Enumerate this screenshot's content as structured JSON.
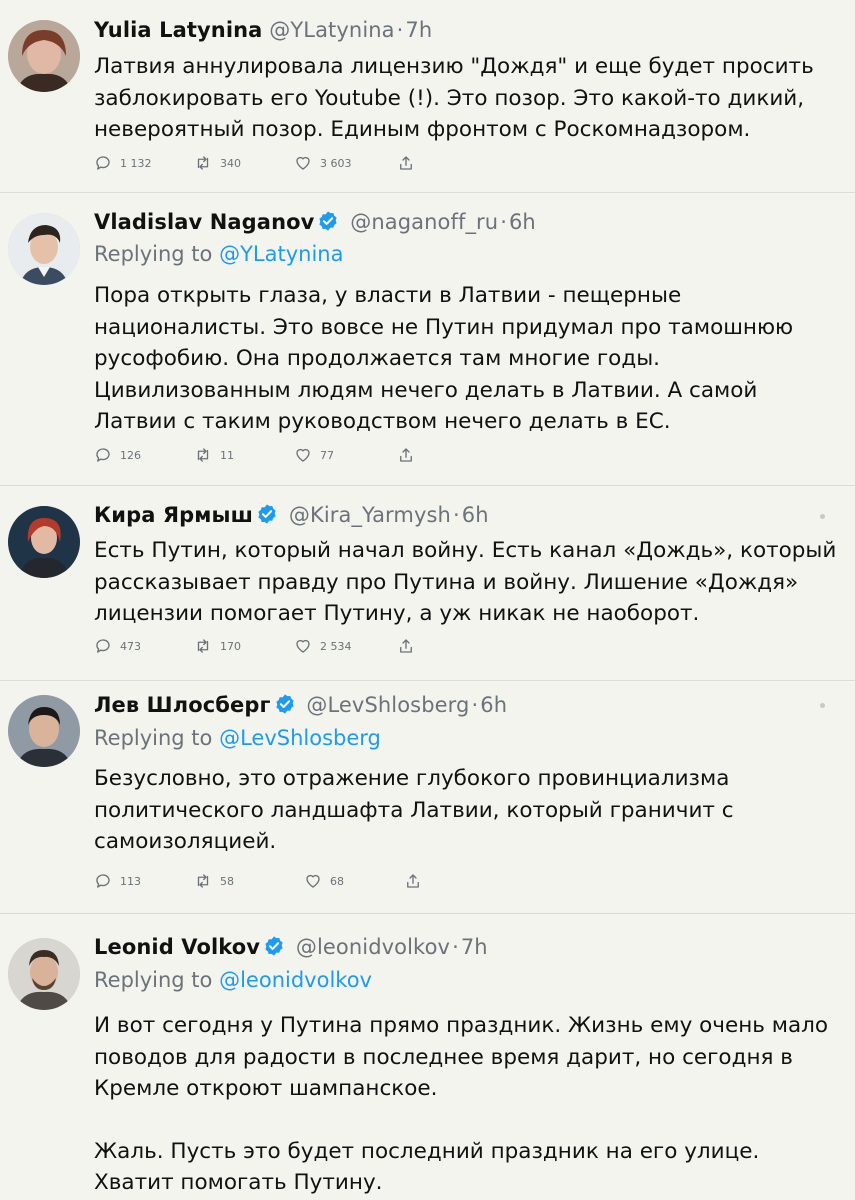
{
  "tweets": [
    {
      "name": "Yulia Latynina",
      "verified": false,
      "handle": "@YLatynina",
      "time": "7h",
      "reply_prefix": "",
      "reply_to": "",
      "text": [
        "Латвия аннулировала лицензию \"Дождя\" и еще будет просить заблокировать его Youtube (!). Это позор. Это какой-то дикий, невероятный позор. Единым фронтом с Роскомнадзором."
      ],
      "replies": "1 132",
      "retweets": "340",
      "likes": "3 603"
    },
    {
      "name": "Vladislav Naganov",
      "verified": true,
      "handle": "@naganoff_ru",
      "time": "6h",
      "reply_prefix": "Replying to",
      "reply_to": "@YLatynina",
      "text": [
        "Пора открыть глаза, у власти в Латвии - пещерные националисты. Это вовсе не Путин придумал про тамошнюю русофобию. Она продолжается там многие годы. Цивилизованным людям нечего делать в Латвии. А самой Латвии с таким руководством нечего делать в ЕС."
      ],
      "replies": "126",
      "retweets": "11",
      "likes": "77"
    },
    {
      "name": "Кира Ярмыш",
      "verified": true,
      "handle": "@Kira_Yarmysh",
      "time": "6h",
      "reply_prefix": "",
      "reply_to": "",
      "text": [
        "Есть Путин, который начал войну. Есть канал «Дождь», который рассказывает правду про Путина и войну. Лишение «Дождя» лицензии помогает Путину, а уж никак не наоборот."
      ],
      "replies": "473",
      "retweets": "170",
      "likes": "2 534"
    },
    {
      "name": "Лев Шлосберг",
      "verified": true,
      "handle": "@LevShlosberg",
      "time": "6h",
      "reply_prefix": "Replying to",
      "reply_to": "@LevShlosberg",
      "text": [
        "Безусловно, это отражение глубокого провинциализма политического ландшафта Латвии, который граничит с самоизоляцией."
      ],
      "replies": "113",
      "retweets": "58",
      "likes": "68"
    },
    {
      "name": "Leonid Volkov",
      "verified": true,
      "handle": "@leonidvolkov",
      "time": "7h",
      "reply_prefix": "Replying to",
      "reply_to": "@leonidvolkov",
      "text": [
        "И вот сегодня у Путина прямо праздник. Жизнь ему очень мало поводов для радости в последнее время дарит, но сегодня в Кремле откроют шампанское.",
        "Жаль. Пусть это будет последний праздник на его улице. Хватит помогать Путину."
      ],
      "replies": "",
      "retweets": "",
      "likes": ""
    }
  ],
  "colors": {
    "background": "#f4f4ef",
    "link": "#1d9bf0",
    "muted": "#6b7279",
    "verified": "#1d9bf0"
  },
  "icons": {
    "reply": "speech-bubble-icon",
    "retweet": "retweet-icon",
    "like": "heart-icon",
    "share": "share-icon",
    "verified": "verified-badge-icon"
  }
}
